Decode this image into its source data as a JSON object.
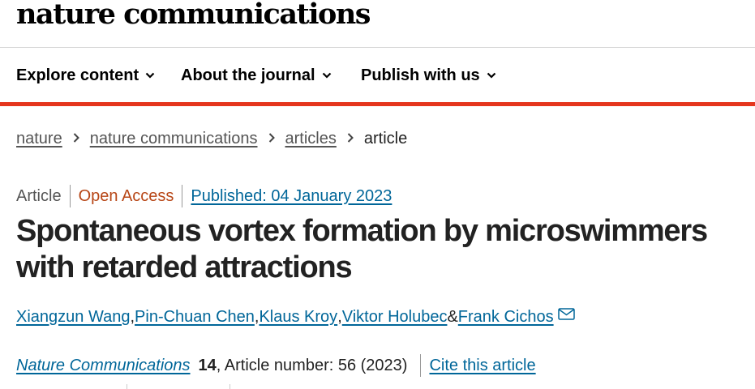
{
  "site": {
    "logo": "nature communications"
  },
  "nav": {
    "items": [
      {
        "label": "Explore content"
      },
      {
        "label": "About the journal"
      },
      {
        "label": "Publish with us"
      }
    ]
  },
  "breadcrumb": {
    "items": [
      "nature",
      "nature communications",
      "articles"
    ],
    "current": "article"
  },
  "article": {
    "type": "Article",
    "access": "Open Access",
    "published": "Published: 04 January 2023",
    "title": "Spontaneous vortex formation by microswimmers with retarded attractions",
    "authors": [
      {
        "name": "Xiangzun Wang",
        "sep": ", "
      },
      {
        "name": "Pin-Chuan Chen",
        "sep": ", "
      },
      {
        "name": "Klaus Kroy",
        "sep": ", "
      },
      {
        "name": "Viktor Holubec",
        "sep": " & "
      },
      {
        "name": "Frank Cichos",
        "sep": ""
      }
    ],
    "journal": "Nature Communications",
    "volume": "14",
    "article_number": ", Article number: 56 (2023)",
    "cite_label": "Cite this article"
  },
  "colors": {
    "accent_red": "#e5361e",
    "link_blue": "#006699",
    "open_access": "#b74616"
  },
  "icons": {
    "nav_chevron": "chevron-down-icon",
    "breadcrumb_sep": "chevron-right-icon",
    "corresponding_author": "envelope-icon"
  }
}
